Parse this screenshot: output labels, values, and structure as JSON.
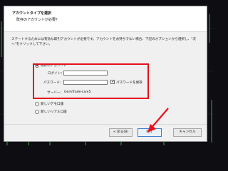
{
  "header": {
    "title": "アカウントタイプを選択",
    "subtitle": "既存のアカウントが必要？"
  },
  "instructions": "ステートするためには有効な取引アカウントが必要です。アカウントをお持ちでない場合、下記のオプションから選択し、\"次へ\"をクリックして下さい。",
  "options": {
    "existing_label": "既存のアカウント",
    "login_label": "ログイン：",
    "login_value": "",
    "password_label": "パスワード：",
    "password_value": "",
    "save_password_label": "パスワードを保存",
    "server_label": "サーバー：",
    "server_value": "GemTrade-Live5",
    "demo_label": "新しいデモ口座",
    "real_label": "新しいリアル口座"
  },
  "buttons": {
    "back": "< 戻る(B)",
    "finish": "完了",
    "cancel": "キャンセル"
  },
  "colors": {
    "highlight": "#e8101a"
  }
}
